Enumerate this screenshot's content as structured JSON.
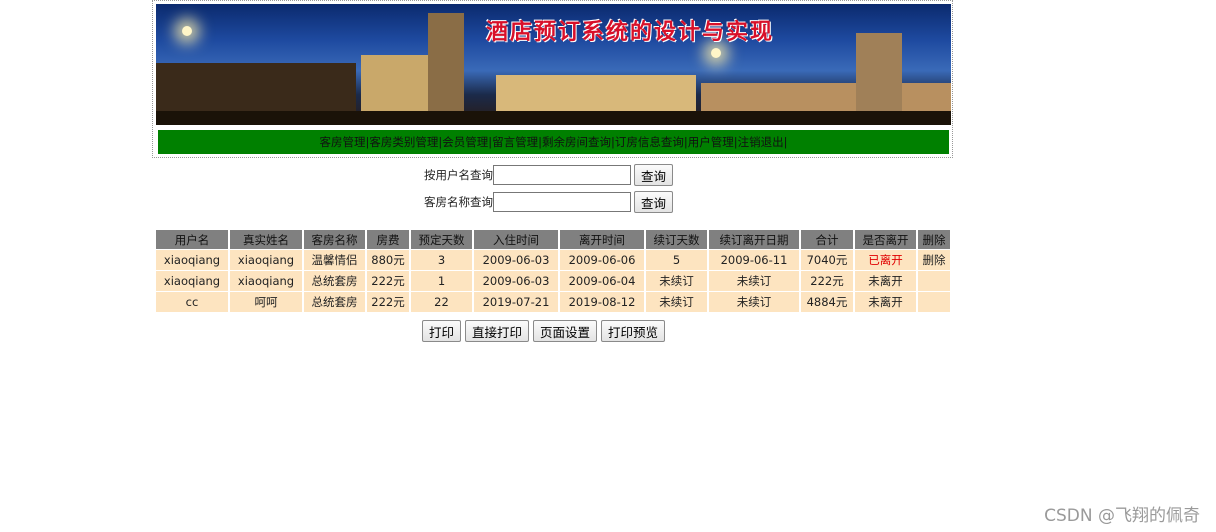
{
  "header": {
    "title": "酒店预订系统的设计与实现",
    "nav": [
      {
        "label": "客房管理|"
      },
      {
        "label": "客房类别管理|"
      },
      {
        "label": "会员管理|"
      },
      {
        "label": "留言管理|"
      },
      {
        "label": "剩余房间查询|"
      },
      {
        "label": "订房信息查询|"
      },
      {
        "label": "用户管理|"
      },
      {
        "label": "注销退出|"
      }
    ]
  },
  "search": {
    "by_user_label": "按用户名查询",
    "by_room_label": "客房名称查询",
    "button": "查询",
    "user_value": "",
    "room_value": ""
  },
  "table": {
    "headers": [
      "用户名",
      "真实姓名",
      "客房名称",
      "房费",
      "预定天数",
      "入住时间",
      "离开时间",
      "续订天数",
      "续订离开日期",
      "合计",
      "是否离开",
      "删除"
    ],
    "rows": [
      [
        "xiaoqiang",
        "xiaoqiang",
        "温馨情侣",
        "880元",
        "3",
        "2009-06-03",
        "2009-06-06",
        "5",
        "2009-06-11",
        "7040元",
        "已离开",
        "删除"
      ],
      [
        "xiaoqiang",
        "xiaoqiang",
        "总统套房",
        "222元",
        "1",
        "2009-06-03",
        "2009-06-04",
        "未续订",
        "未续订",
        "222元",
        "未离开",
        ""
      ],
      [
        "cc",
        "呵呵",
        "总统套房",
        "222元",
        "22",
        "2019-07-21",
        "2019-08-12",
        "未续订",
        "未续订",
        "4884元",
        "未离开",
        ""
      ]
    ]
  },
  "print": {
    "print": "打印",
    "direct_print": "直接打印",
    "page_setup": "页面设置",
    "preview": "打印预览"
  },
  "watermark": "CSDN @飞翔的佩奇",
  "colors": {
    "nav_bg": "#008000",
    "header_cell": "#808080",
    "row_bg": "#fde4c0",
    "left_status": "#e00000",
    "title": "#d8102a"
  }
}
